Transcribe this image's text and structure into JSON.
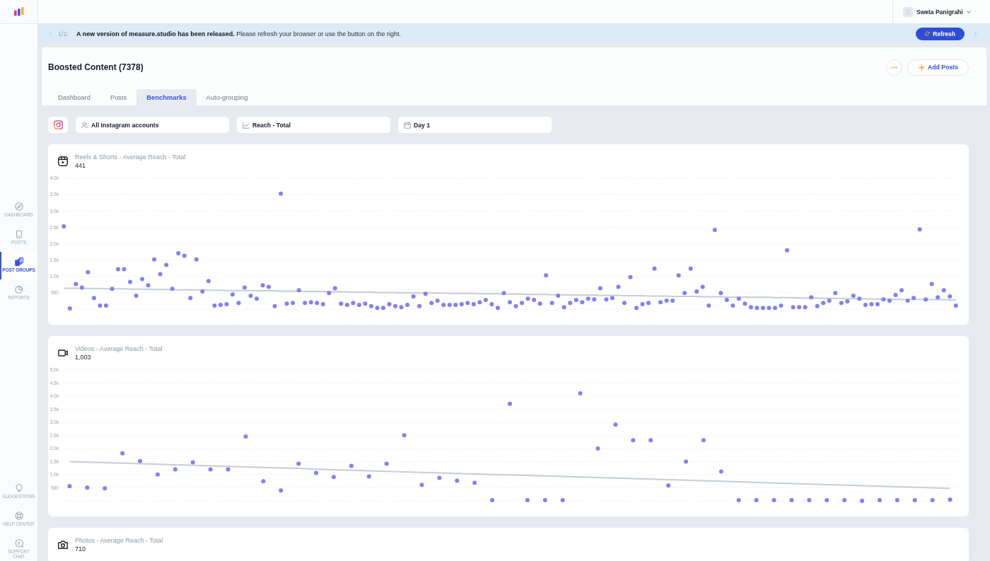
{
  "sidebar": {
    "items": [
      {
        "label": "DASHBOARD",
        "selected": false
      },
      {
        "label": "POSTS",
        "selected": false
      },
      {
        "label": "POST GROUPS",
        "selected": true
      },
      {
        "label": "REPORTS",
        "selected": false
      }
    ],
    "bottom_items": [
      {
        "label": "SUGGESTIONS"
      },
      {
        "label": "HELP CENTER"
      },
      {
        "label": "SUPPORT CHAT"
      }
    ]
  },
  "top_bar": {
    "user_name": "Sweta Panigrahi"
  },
  "banner": {
    "counter": "1/1:",
    "message": "**A new version of measure.studio has been released.** Please refresh your browser or use the button on the right.",
    "button": "Refresh"
  },
  "header": {
    "title": "Boosted Content (7378)",
    "add_button": "Add Posts"
  },
  "tabs": [
    {
      "label": "Dashboard",
      "selected": false
    },
    {
      "label": "Posts",
      "selected": false
    },
    {
      "label": "Benchmarks",
      "selected": true
    },
    {
      "label": "Auto-grouping",
      "selected": false
    }
  ],
  "filters": [
    {
      "value": "All Instagram accounts"
    },
    {
      "value": "Reach - Total"
    },
    {
      "value": "Day 1"
    }
  ],
  "charts": [
    {
      "title": "Reels & Shorts - Average Reach - Total",
      "value": "441",
      "chart_data": {
        "type": "scatter",
        "grid": true,
        "ylim": [
          0,
          4000
        ],
        "yticks": [
          500,
          {
            "value": 1000,
            "label": "1.0k"
          },
          {
            "value": 1500,
            "label": "1.5k"
          },
          {
            "value": 2000,
            "label": "2.0k"
          },
          {
            "value": 2500,
            "label": "2.5k"
          },
          {
            "value": 3000,
            "label": "3.0k"
          },
          {
            "value": 3500,
            "label": "3.5k"
          },
          {
            "value": 4000,
            "label": "4.0k"
          }
        ],
        "series": [
          {
            "color": "#7f80f6",
            "values": [
              2530,
              20,
              770,
              660,
              1130,
              340,
              110,
              110,
              620,
              1220,
              1220,
              830,
              410,
              920,
              730,
              1520,
              1070,
              1350,
              620,
              1710,
              1630,
              340,
              1520,
              540,
              860,
              110,
              130,
              150,
              450,
              190,
              660,
              410,
              320,
              730,
              680,
              90,
              3530,
              170,
              190,
              580,
              190,
              210,
              190,
              150,
              490,
              640,
              170,
              130,
              190,
              130,
              170,
              90,
              40,
              40,
              150,
              90,
              60,
              130,
              390,
              90,
              470,
              190,
              260,
              130,
              130,
              130,
              150,
              190,
              150,
              210,
              280,
              150,
              40,
              490,
              210,
              90,
              190,
              320,
              280,
              170,
              1030,
              190,
              410,
              60,
              190,
              280,
              210,
              320,
              300,
              640,
              300,
              340,
              680,
              190,
              980,
              40,
              150,
              190,
              1240,
              210,
              260,
              260,
              1030,
              490,
              1240,
              540,
              680,
              110,
              2420,
              490,
              280,
              110,
              320,
              170,
              60,
              40,
              40,
              40,
              40,
              110,
              1800,
              60,
              60,
              60,
              360,
              90,
              190,
              260,
              490,
              190,
              240,
              410,
              320,
              130,
              150,
              150,
              300,
              260,
              430,
              580,
              260,
              340,
              2440,
              300,
              770,
              360,
              580,
              390,
              110
            ]
          },
          {
            "type": "line",
            "color": "#c6cdd6",
            "values": [
              640,
              640,
              640,
              630,
              630,
              630,
              630,
              620,
              620,
              620,
              620,
              610,
              610,
              610,
              610,
              600,
              600,
              600,
              600,
              590,
              590,
              590,
              590,
              580,
              580,
              580,
              580,
              570,
              570,
              570,
              570,
              570,
              560,
              560,
              560,
              560,
              550,
              550,
              550,
              550,
              540,
              540,
              540,
              540,
              530,
              530,
              530,
              530,
              520,
              520,
              520,
              520,
              510,
              510,
              510,
              510,
              500,
              500,
              500,
              500,
              490,
              490,
              490,
              490,
              480,
              480,
              480,
              480,
              480,
              470,
              470,
              470,
              470,
              460,
              460,
              460,
              460,
              450,
              450,
              450,
              450,
              440,
              440,
              440,
              440,
              430,
              430,
              430,
              430,
              420,
              420,
              420,
              420,
              410,
              410,
              410,
              410,
              400,
              400,
              400,
              400,
              390,
              390,
              390,
              390,
              390,
              380,
              380,
              380,
              380,
              370,
              370,
              370,
              370,
              360,
              360,
              360,
              360,
              350,
              350,
              350,
              350,
              340,
              340,
              340,
              340,
              330,
              330,
              330,
              330,
              320,
              320,
              320,
              320,
              310,
              310,
              310,
              310,
              300,
              300,
              300,
              300,
              300,
              290,
              290,
              290,
              290,
              280,
              280
            ]
          }
        ]
      }
    },
    {
      "title": "Videos - Average Reach - Total",
      "value": "1,003",
      "chart_data": {
        "type": "scatter",
        "grid": true,
        "ylim": [
          0,
          5000
        ],
        "yticks": [
          500,
          {
            "value": 1000,
            "label": "1.0k"
          },
          {
            "value": 1500,
            "label": "1.5k"
          },
          {
            "value": 2000,
            "label": "2.0k"
          },
          {
            "value": 2500,
            "label": "2.5k"
          },
          {
            "value": 3000,
            "label": "3.0k"
          },
          {
            "value": 3500,
            "label": "3.5k"
          },
          {
            "value": 4000,
            "label": "4.0k"
          },
          {
            "value": 4500,
            "label": "4.5k"
          },
          {
            "value": 5000,
            "label": "5.0k"
          }
        ],
        "series": [
          {
            "color": "#7f80f6",
            "values": [
              560,
              510,
              480,
              1820,
              1520,
              1010,
              1200,
              1470,
              1200,
              1200,
              2460,
              750,
              400,
              1420,
              1070,
              910,
              1340,
              930,
              1420,
              2510,
              610,
              880,
              770,
              690,
              30,
              3710,
              30,
              30,
              30,
              4110,
              2000,
              2910,
              2320,
              2320,
              590,
              1500,
              2320,
              1120,
              30,
              30,
              30,
              30,
              30,
              30,
              30,
              0,
              30,
              30,
              30,
              30,
              50
            ]
          },
          {
            "type": "line",
            "color": "#c6cdd6",
            "values": [
              1500,
              1480,
              1460,
              1440,
              1420,
              1400,
              1380,
              1360,
              1340,
              1320,
              1300,
              1280,
              1260,
              1240,
              1210,
              1190,
              1170,
              1150,
              1130,
              1110,
              1090,
              1070,
              1050,
              1030,
              1010,
              990,
              970,
              950,
              930,
              910,
              890,
              870,
              850,
              830,
              810,
              790,
              770,
              750,
              730,
              700,
              680,
              660,
              640,
              620,
              600,
              580,
              560,
              540,
              520,
              500,
              480
            ]
          }
        ]
      }
    },
    {
      "title": "Photos - Average Reach - Total",
      "value": "710"
    }
  ]
}
